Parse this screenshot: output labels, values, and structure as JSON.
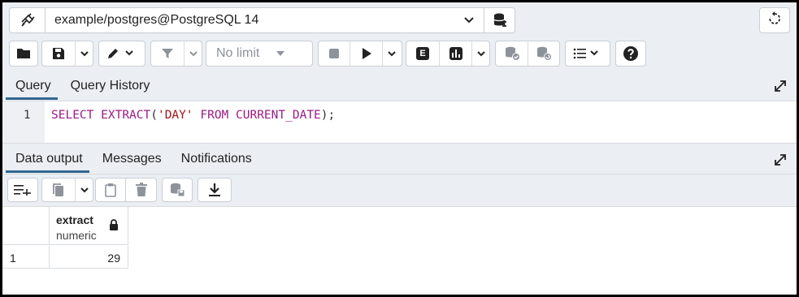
{
  "connection": {
    "title": "example/postgres@PostgreSQL 14",
    "plug_icon": "plug-icon",
    "dropdown_icon": "chevron-down-icon",
    "db_icon": "database-icon",
    "reset_icon": "reset-layout-icon"
  },
  "toolbar": {
    "limit_label": "No limit",
    "icons": [
      "folder-icon",
      "save-icon",
      "chevron-down-icon",
      "edit-pen-icon",
      "chevron-down-icon",
      "filter-icon",
      "chevron-down-icon",
      "stop-icon",
      "execute-icon",
      "chevron-down-icon",
      "explain-icon",
      "explain-analyze-icon",
      "chevron-down-icon",
      "commit-icon",
      "rollback-icon",
      "macros-icon",
      "help-icon"
    ],
    "explain_letter": "E"
  },
  "query_tabs": [
    {
      "label": "Query",
      "active": true
    },
    {
      "label": "Query History",
      "active": false
    }
  ],
  "editor": {
    "line_number": "1",
    "tokens": {
      "select": "SELECT",
      "extract": "EXTRACT",
      "open": "(",
      "day": "'DAY'",
      "from": "FROM",
      "current_date": "CURRENT_DATE",
      "close": ");"
    }
  },
  "output_tabs": [
    {
      "label": "Data output",
      "active": true
    },
    {
      "label": "Messages",
      "active": false
    },
    {
      "label": "Notifications",
      "active": false
    }
  ],
  "grid": {
    "columns": [
      {
        "name": "extract",
        "type": "numeric"
      }
    ],
    "rows": [
      {
        "row_number": "1",
        "values": [
          "29"
        ]
      }
    ]
  },
  "colors": {
    "accent": "#326690",
    "keyword": "#9c1a84",
    "string": "#a31515",
    "background": "#ebeef3"
  }
}
